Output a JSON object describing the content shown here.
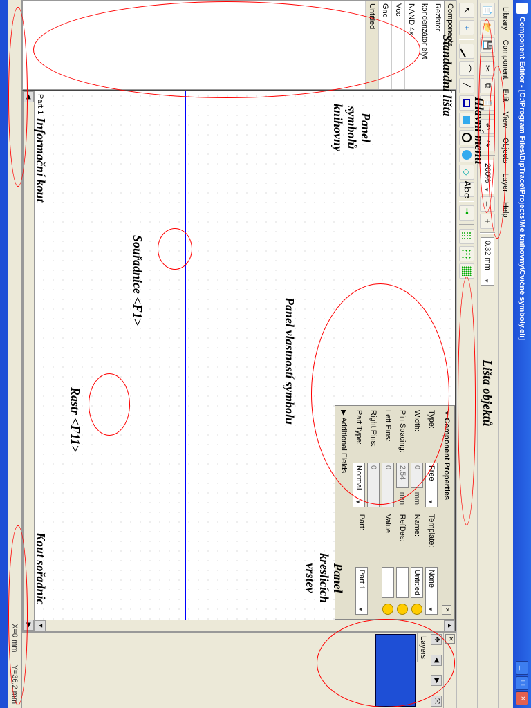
{
  "window": {
    "title": "Component Editor - [C:\\Program Files\\DipTrace\\Projects\\Mé knihovny\\Cvičné symboly.eli]"
  },
  "menu": {
    "library": "Library",
    "component": "Component",
    "edit": "Edit",
    "view": "View",
    "objects": "Objects",
    "layer": "Layer",
    "help": "Help"
  },
  "toolbar": {
    "zoom": "200%",
    "linewidth": "0.32 mm"
  },
  "symbols": {
    "tab": "Components",
    "items": [
      "Rezistor",
      "kondenzátor elyt",
      "NAND 4x",
      "Vcc",
      "Gnd",
      "Untitled"
    ]
  },
  "props": {
    "header": "Component Properties",
    "additional": "Additional Fields",
    "type_label": "Type:",
    "type_value": "Free",
    "template_label": "Template:",
    "template_value": "None",
    "width_label": "Width:",
    "width_value": "0",
    "name_label": "Name:",
    "name_value": "Untitled",
    "pinspacing_label": "Pin Spacing:",
    "pinspacing_value": "2.54",
    "refdes_label": "RefDes:",
    "refdes_value": "",
    "leftpins_label": "Left Pins:",
    "leftpins_value": "0",
    "value_label": "Value:",
    "value_value": "",
    "rightpins_label": "Right Pins:",
    "rightpins_value": "0",
    "parttype_label": "Part Type:",
    "parttype_value": "Normal",
    "part_label": "Part:",
    "part_value": "Part 1",
    "mm": "mm"
  },
  "canvas": {
    "tab": "Part 1"
  },
  "layers": {
    "label": "Layers"
  },
  "status": {
    "x": "X=0 mm",
    "y": "Y=36.2 mm"
  },
  "annotations": {
    "mainmenu": "Hlavní menu",
    "stdbar": "Standardní lišta",
    "objbar": "Lišta objektů",
    "sympanel": "Panel\nsymbolů\nknihovny",
    "proppanel": "Panel vlastností symbolu",
    "layerspanel": "Panel\nkreslicích\nvrstev",
    "coords": "Souřadnice <F1>",
    "grid": "Rastr <F11>",
    "infocorner": "Informační kout",
    "coordcorner": "Kout sořadnic"
  }
}
